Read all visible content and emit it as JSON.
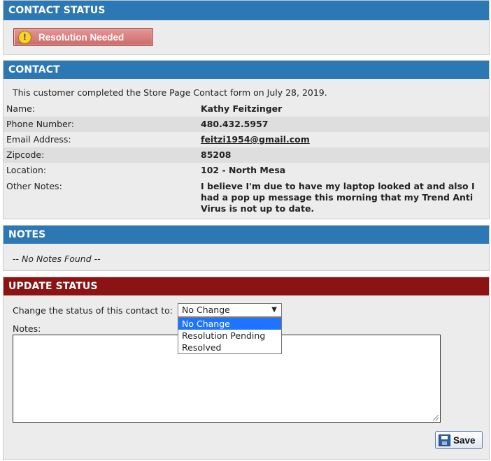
{
  "contact_status": {
    "header": "CONTACT STATUS",
    "status_button": "Resolution Needed",
    "status_icon": "warning-icon",
    "status_color": "#cd6a6a"
  },
  "contact": {
    "header": "CONTACT",
    "intro": "This customer completed the Store Page Contact form on July 28, 2019.",
    "fields": [
      {
        "label": "Name:",
        "value": "Kathy Feitzinger"
      },
      {
        "label": "Phone Number:",
        "value": "480.432.5957"
      },
      {
        "label": "Email Address:",
        "value": "feitzi1954@gmail.com"
      },
      {
        "label": "Zipcode:",
        "value": "85208"
      },
      {
        "label": "Location:",
        "value": "102 - North Mesa"
      }
    ],
    "other_notes_label": "Other Notes:",
    "other_notes_value": "I believe I'm due to have my laptop looked at and also I had a pop up message this morning that my Trend Anti Virus is not up to date."
  },
  "notes": {
    "header": "NOTES",
    "empty_text": "-- No Notes Found --"
  },
  "update_status": {
    "header": "UPDATE STATUS",
    "change_label": "Change the status of this contact to:",
    "selected": "No Change",
    "options": [
      "No Change",
      "Resolution Pending",
      "Resolved"
    ],
    "notes_label": "Notes:",
    "notes_value": "",
    "save_label": "Save",
    "save_icon": "floppy-disk-icon"
  },
  "colors": {
    "header_blue": "#2c78b5",
    "header_red": "#8b1313",
    "panel_bg": "#ececec",
    "dropdown_highlight": "#1e74ff"
  }
}
